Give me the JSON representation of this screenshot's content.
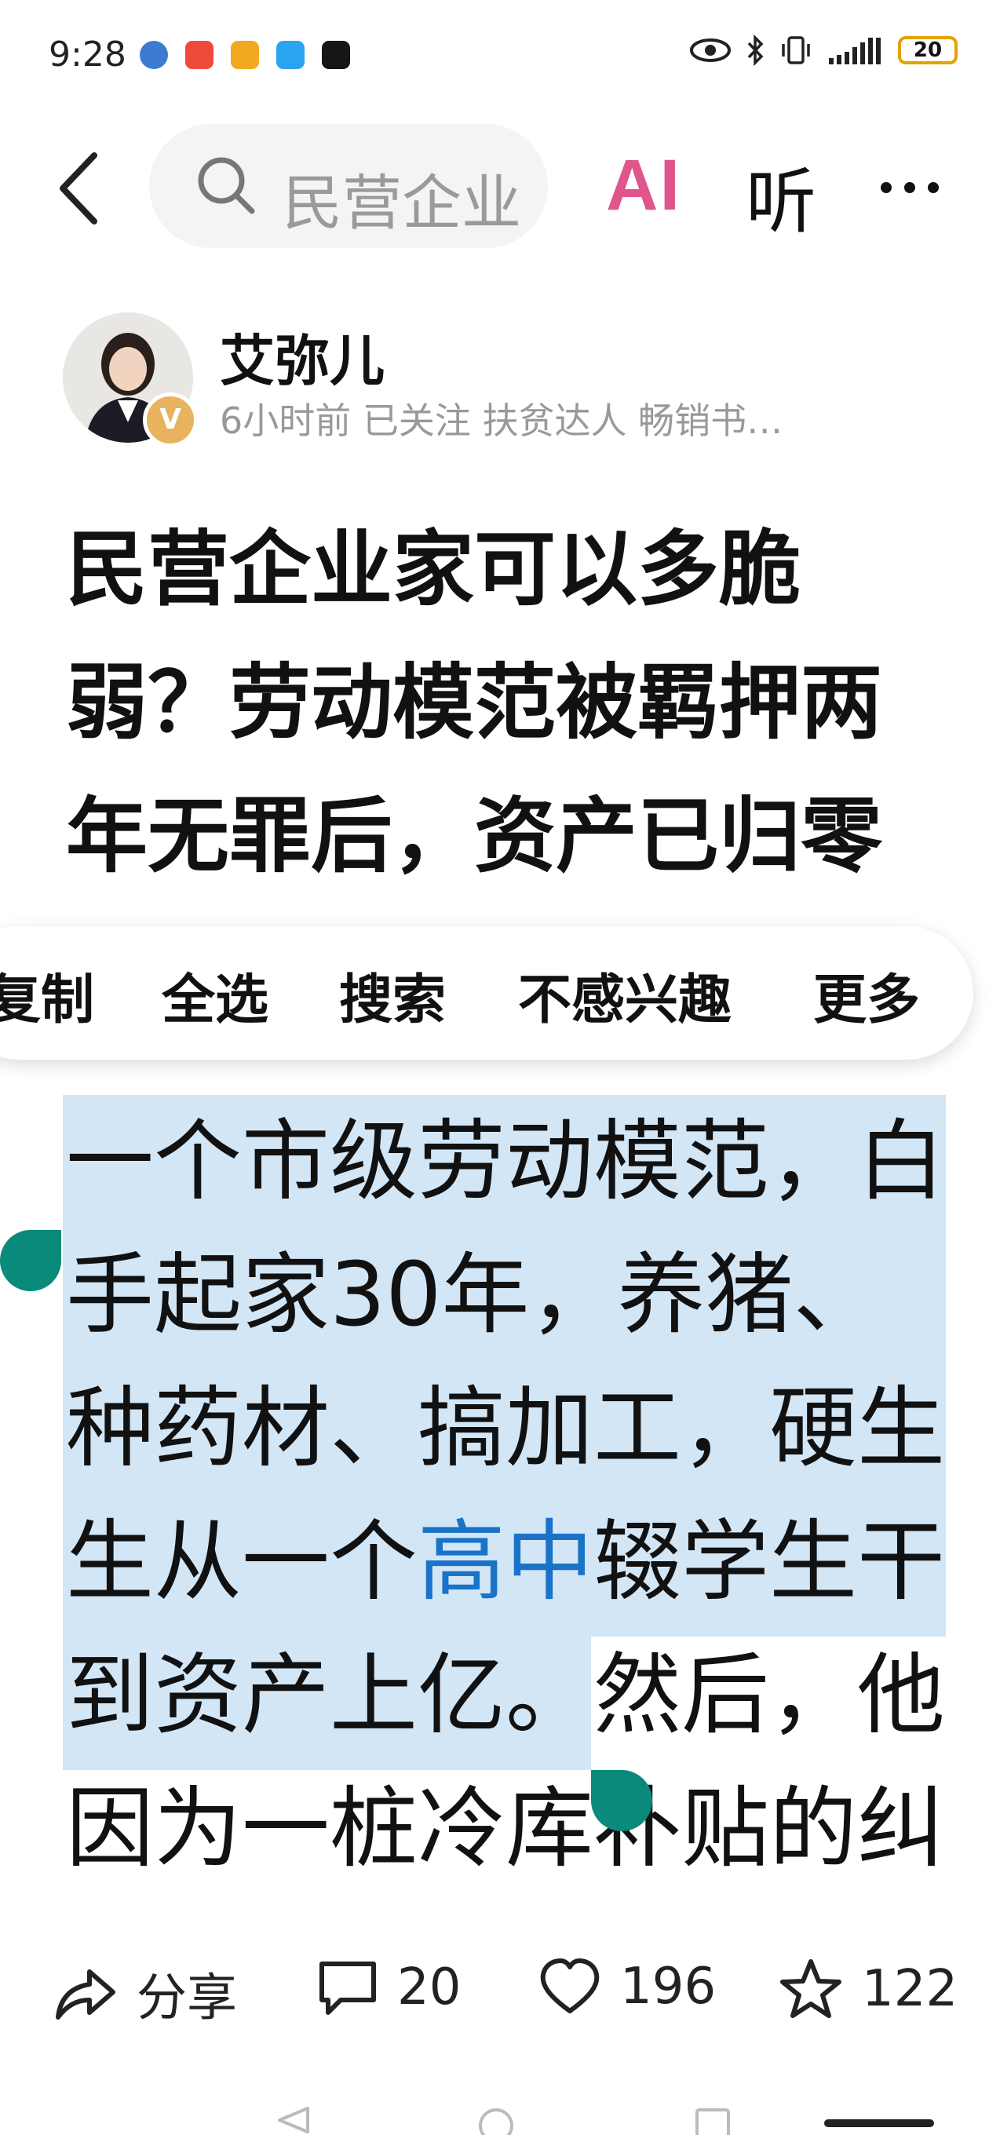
{
  "status_bar": {
    "time": "9:28",
    "battery": "20"
  },
  "nav": {
    "search_text": "民营企业",
    "ai_label": "AI",
    "listen_label": "听"
  },
  "author": {
    "name": "艾弥儿",
    "badge": "V",
    "meta": "6小时前  已关注  扶贫达人  畅销书…"
  },
  "article": {
    "title": "民营企业家可以多脆弱？劳动模范被羁押两年无罪后，资产已归零",
    "body_lines": [
      "一个市级劳动模范，白",
      "手起家30年，养猪、",
      "种药材、搞加工，硬生",
      "生从一个",
      "高中",
      "辍学生干",
      "到资产上亿。",
      "然后，他",
      "因为一桩冷库补贴的纠"
    ]
  },
  "context_menu": {
    "items": [
      "复制",
      "全选",
      "搜索",
      "不感兴趣",
      "更多"
    ]
  },
  "actions": {
    "share_label": "分享",
    "comments": "20",
    "likes": "196",
    "favorites": "122"
  }
}
